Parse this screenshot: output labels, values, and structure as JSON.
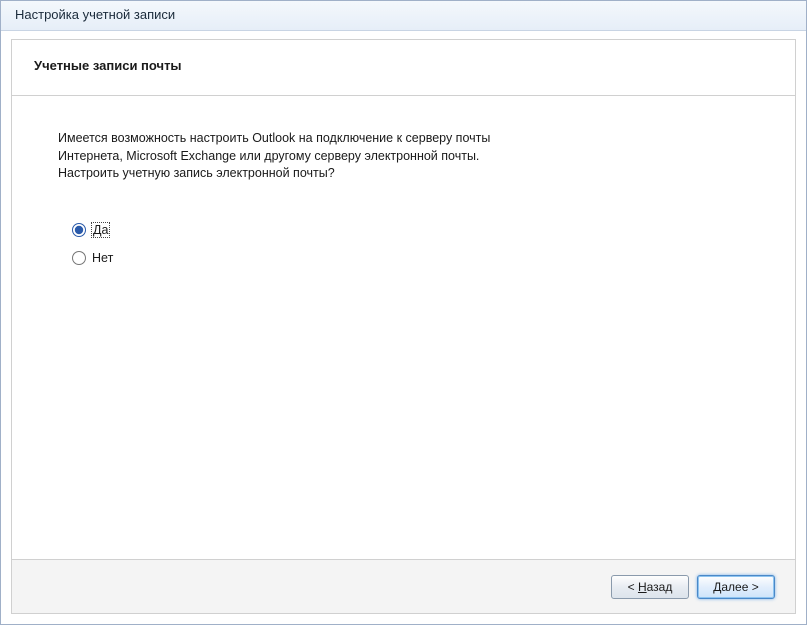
{
  "window": {
    "title": "Настройка учетной записи"
  },
  "header": {
    "title": "Учетные записи почты"
  },
  "body": {
    "description_l1": "Имеется возможность настроить Outlook на подключение к серверу почты",
    "description_l2": "Интернета, Microsoft Exchange или другому серверу электронной почты.",
    "description_l3": "Настроить учетную запись электронной почты?",
    "options": {
      "yes": "Да",
      "no": "Нет",
      "selected": "yes"
    }
  },
  "footer": {
    "back_pre": "< ",
    "back_u": "Н",
    "back_post": "азад",
    "next_u": "Д",
    "next_post": "алее >"
  }
}
